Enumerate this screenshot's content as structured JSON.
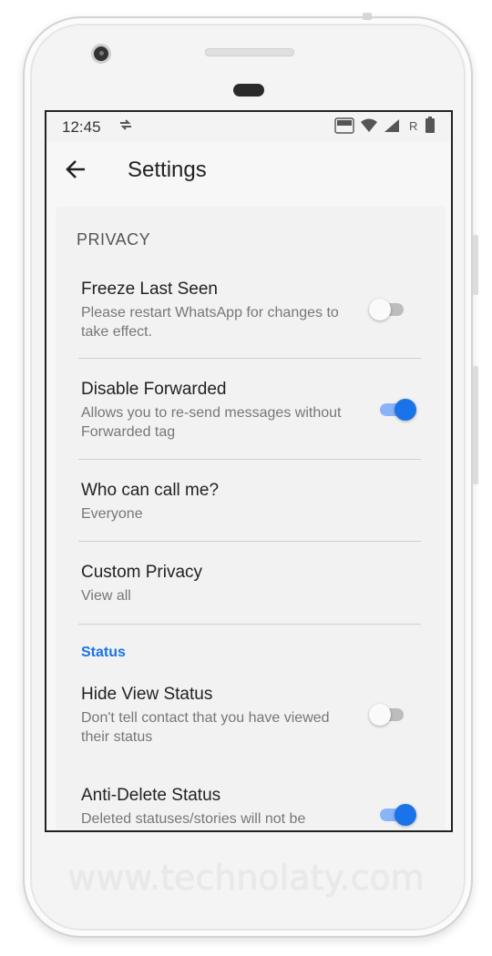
{
  "statusbar": {
    "time": "12:45",
    "icons": [
      "sync-icon",
      "volte-icon",
      "wifi-icon",
      "signal-icon",
      "roaming-indicator",
      "battery-icon"
    ],
    "volte_label": "VO LTE",
    "roaming_label": "R"
  },
  "appbar": {
    "back_icon": "arrow-back-icon",
    "title": "Settings"
  },
  "privacy": {
    "header": "PRIVACY",
    "items": [
      {
        "title": "Freeze Last Seen",
        "subtitle": "Please restart WhatsApp for changes to take effect.",
        "toggle": false
      },
      {
        "title": "Disable Forwarded",
        "subtitle": "Allows you to re-send messages without Forwarded tag",
        "toggle": true
      },
      {
        "title": "Who can call me?",
        "subtitle": "Everyone"
      },
      {
        "title": "Custom Privacy",
        "subtitle": "View all"
      }
    ]
  },
  "status": {
    "header": "Status",
    "items": [
      {
        "title": "Hide View Status",
        "subtitle": "Don't tell contact that you have viewed their status",
        "toggle": false
      },
      {
        "title": "Anti-Delete Status",
        "subtitle": "Deleted statuses/stories will not be",
        "toggle": true
      }
    ]
  },
  "colors": {
    "accent": "#1a73e8",
    "toggle_on_track": "#8ab4f8",
    "toggle_off_track": "#bdbdbd"
  },
  "watermark": "www.technolaty.com"
}
